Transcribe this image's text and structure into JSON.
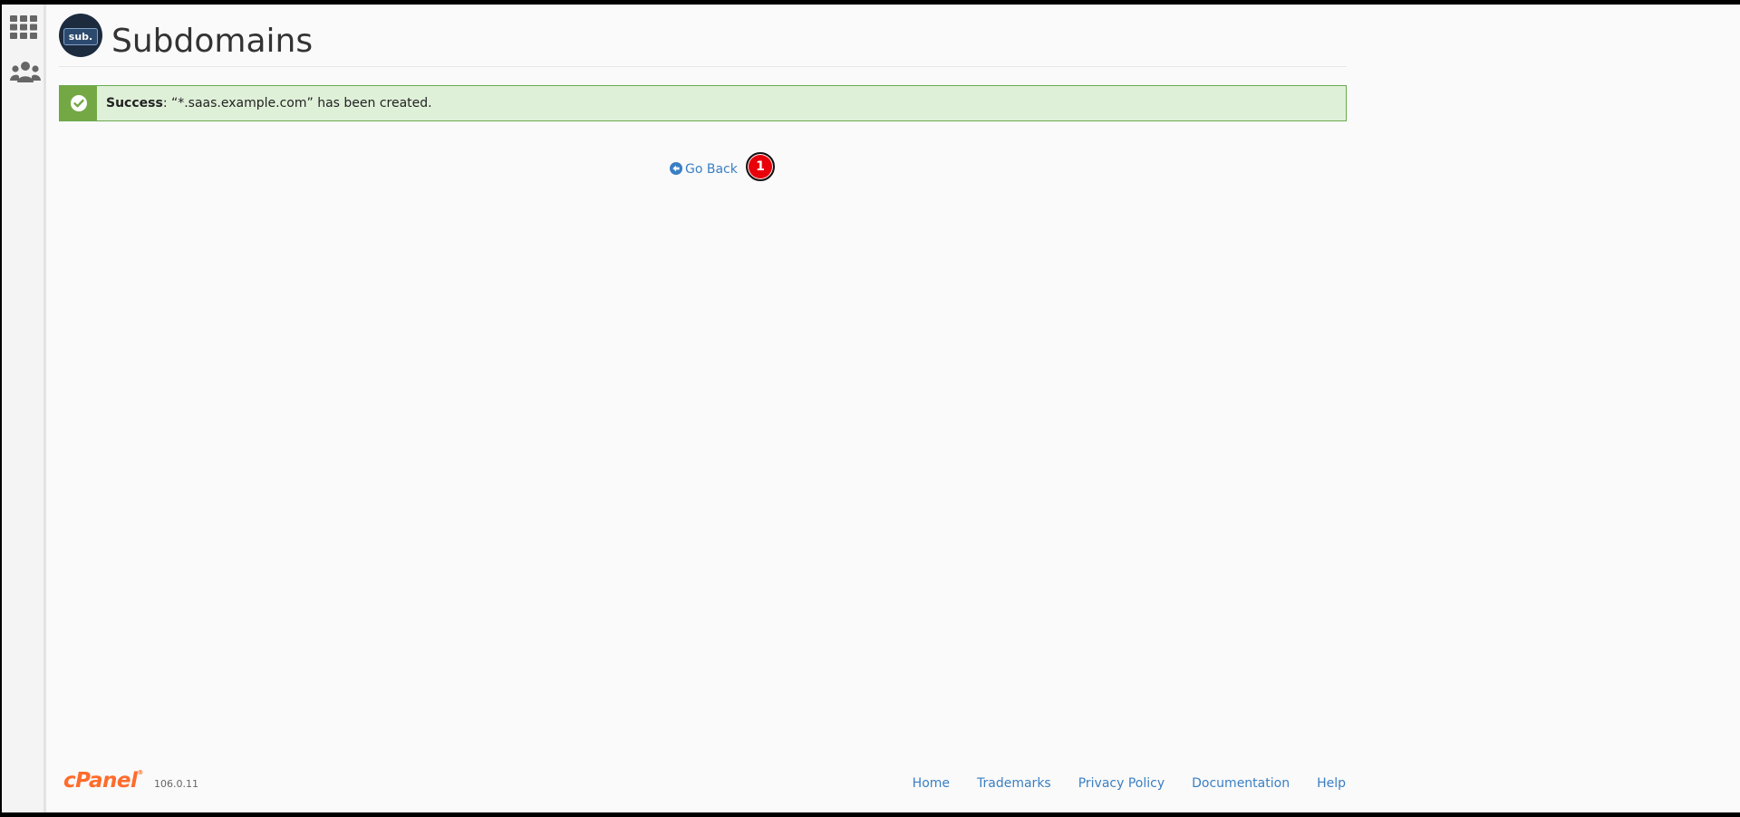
{
  "page": {
    "title": "Subdomains",
    "icon_label": "sub."
  },
  "sidebar": {
    "items": [
      {
        "name": "apps-grid-icon"
      },
      {
        "name": "users-icon"
      }
    ]
  },
  "alert": {
    "status_label": "Success",
    "message": ": “*.saas.example.com” has been created."
  },
  "actions": {
    "go_back_label": "Go Back",
    "marker_label": "1"
  },
  "footer": {
    "logo_text": "cPanel",
    "logo_mark": "®",
    "version": "106.0.11",
    "links": [
      "Home",
      "Trademarks",
      "Privacy Policy",
      "Documentation",
      "Help"
    ]
  },
  "colors": {
    "link": "#3a7fc4",
    "success_bg": "#dff0d8",
    "success_icon_bg": "#74a845",
    "brand": "#ff6c2c",
    "marker": "#e8000b"
  }
}
